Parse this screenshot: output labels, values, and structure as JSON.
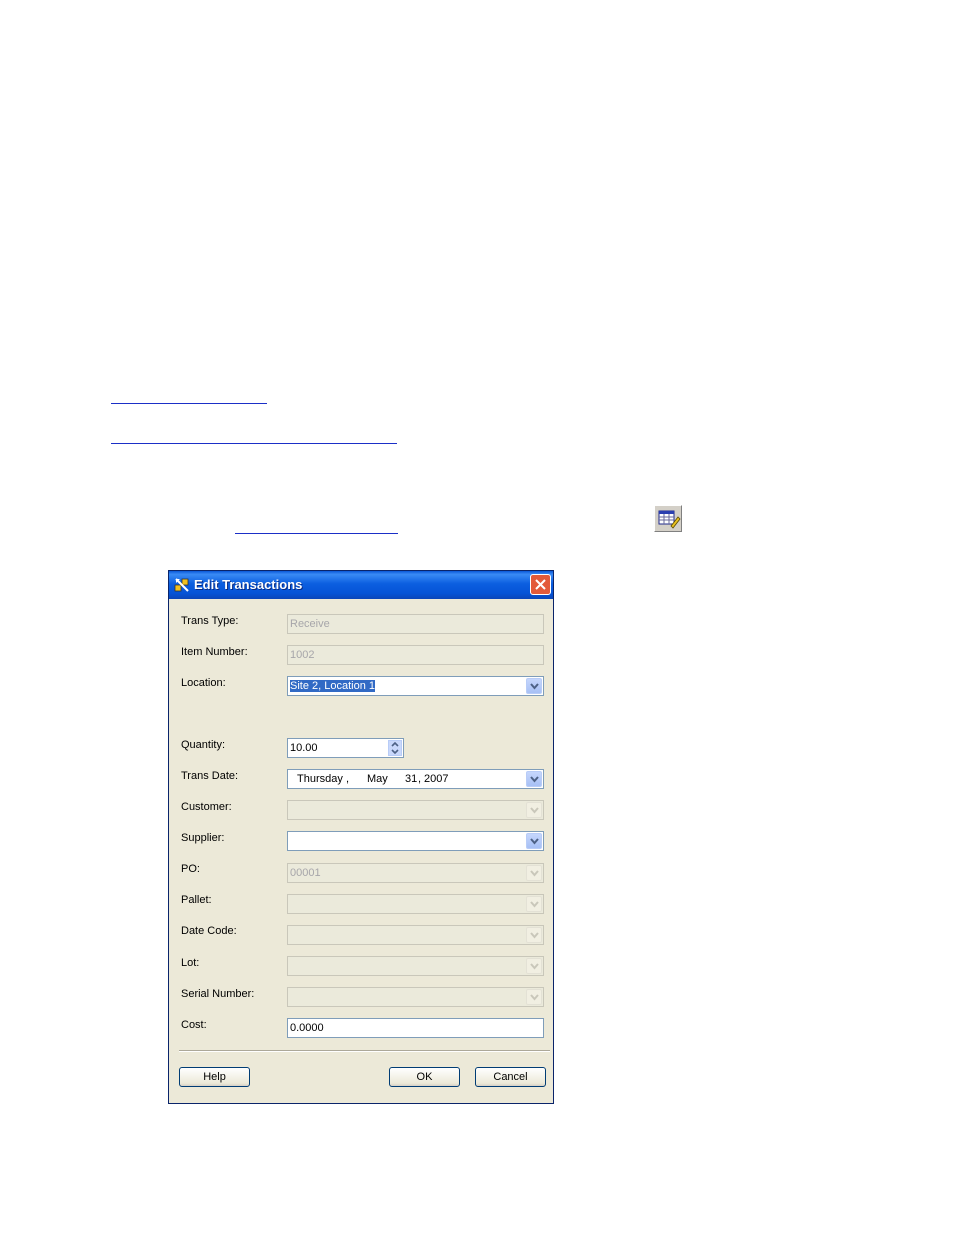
{
  "toolbar": {
    "edit_icon": "edit-transaction-icon"
  },
  "dialog": {
    "title": "Edit Transactions",
    "fields": {
      "trans_type": {
        "label": "Trans Type:",
        "value": "Receive"
      },
      "item_number": {
        "label": "Item Number:",
        "value": "1002"
      },
      "location": {
        "label": "Location:",
        "value": "Site 2, Location 1"
      },
      "quantity": {
        "label": "Quantity:",
        "value": "10.00"
      },
      "trans_date": {
        "label": "Trans Date:",
        "weekday": "Thursday",
        "sep1": ",",
        "month": "May",
        "day": "31",
        "sep2": ",",
        "year": "2007"
      },
      "customer": {
        "label": "Customer:",
        "value": ""
      },
      "supplier": {
        "label": "Supplier:",
        "value": ""
      },
      "po": {
        "label": "PO:",
        "value": "00001"
      },
      "pallet": {
        "label": "Pallet:",
        "value": ""
      },
      "date_code": {
        "label": "Date Code:",
        "value": ""
      },
      "lot": {
        "label": "Lot:",
        "value": ""
      },
      "serial_number": {
        "label": "Serial Number:",
        "value": ""
      },
      "cost": {
        "label": "Cost:",
        "value": "0.0000"
      }
    },
    "buttons": {
      "help": "Help",
      "ok": "OK",
      "cancel": "Cancel"
    }
  }
}
